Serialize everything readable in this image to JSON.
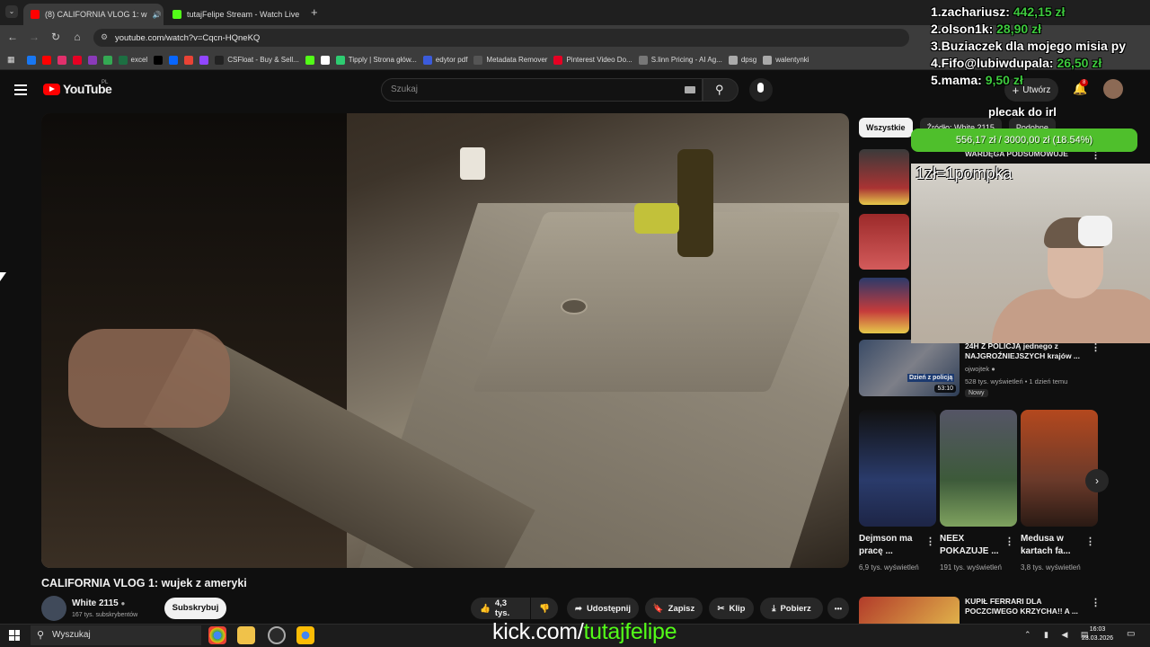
{
  "browser": {
    "tabs": [
      {
        "title": "(8) CALIFORNIA VLOG 1: w",
        "active": true,
        "favicon_color": "#ff0000"
      },
      {
        "title": "tutajFelipe Stream - Watch Live",
        "active": false,
        "favicon_color": "#53fc18"
      }
    ],
    "new_tab": "+",
    "url": "youtube.com/watch?v=Cqcn-HQneKQ",
    "bookmarks": [
      {
        "label": "",
        "color": "#1877f2"
      },
      {
        "label": "",
        "color": "#ff0000"
      },
      {
        "label": "",
        "color": "#e1306c"
      },
      {
        "label": "",
        "color": "#e60023"
      },
      {
        "label": "",
        "color": "#8a3ab9"
      },
      {
        "label": "",
        "color": "#34a853"
      },
      {
        "label": "excel",
        "color": "#1d6f42"
      },
      {
        "label": "",
        "color": "#000000"
      },
      {
        "label": "",
        "color": "#0866ff"
      },
      {
        "label": "",
        "color": "#ea4335"
      },
      {
        "label": "",
        "color": "#9146ff"
      },
      {
        "label": "CSFloat - Buy & Sell...",
        "color": "#222222"
      },
      {
        "label": "",
        "color": "#53fc18"
      },
      {
        "label": "",
        "color": "#ffffff"
      },
      {
        "label": "Tipply | Strona głów...",
        "color": "#2ecc71"
      },
      {
        "label": "edytor pdf",
        "color": "#3b5bdb"
      },
      {
        "label": "Metadata Remover",
        "color": "#555555"
      },
      {
        "label": "Pinterest Video Do...",
        "color": "#e60023"
      },
      {
        "label": "S.linn Pricing - AI Ag...",
        "color": "#777777"
      },
      {
        "label": "dpsg",
        "color": "#aaaaaa"
      },
      {
        "label": "walentynki",
        "color": "#aaaaaa"
      }
    ]
  },
  "youtube": {
    "logo_text": "YouTube",
    "country": "PL",
    "search_placeholder": "Szukaj",
    "create_label": "Utwórz",
    "notifications": "8",
    "video_title": "CALIFORNIA VLOG 1: wujek z ameryki",
    "channel_name": "White 2115",
    "channel_subs": "167 tys. subskrybentów",
    "subscribe_label": "Subskrybuj",
    "likes": "4,3 tys.",
    "share_label": "Udostępnij",
    "save_label": "Zapisz",
    "clip_label": "Klip",
    "download_label": "Pobierz",
    "more_label": "•••",
    "chips": [
      "Wszystkie",
      "Źródło: White 2115",
      "Podobne"
    ],
    "rec": {
      "title": "24H Z POLICJĄ jednego z NAJGROŹNIEJSZYCH krajów ...",
      "thumb_text": "Dzień z policją",
      "duration": "53:10",
      "channel": "ojwojtek",
      "meta": "528 tys. wyświetleń • 1 dzień temu",
      "badge": "Nowy"
    },
    "partial_rec_title": "WARDĘGA PODSUMOWUJE",
    "shorts": [
      {
        "title": "Dejmson ma pracę ...",
        "views": "6,9 tys. wyświetleń",
        "color": "#2a3b6b"
      },
      {
        "title": "NEEX POKAZUJE ...",
        "views": "191 tys. wyświetleń",
        "color": "#3d5a3a"
      },
      {
        "title": "Medusa w kartach fa...",
        "views": "3,8 tys. wyświetleń",
        "color": "#6b3a2a"
      }
    ],
    "bottom_rec_title": "KUPIŁ FERRARI DLA POCZCIWEGO KRZYCHA!! A ..."
  },
  "stream_overlay": {
    "leaderboard": [
      {
        "name": "1.zachariusz:",
        "amount": "442,15 zł"
      },
      {
        "name": "2.olson1k:",
        "amount": "28,90 zł"
      },
      {
        "name": "3.Buziaczek dla mojego misia py",
        "amount": ""
      },
      {
        "name": "4.Fifo@lubiwdupala:",
        "amount": "26,50 zł"
      },
      {
        "name": "5.mama:",
        "amount": "9,50 zł"
      }
    ],
    "goal_title": "plecak do irl",
    "goal_text": "556,17 zł / 3000,00 zł (18.54%)",
    "goal_fraction": 0.1854,
    "pompka": "1zł=1pompka",
    "kick_prefix": "kick.com/",
    "kick_channel": "tutajfelipe"
  },
  "taskbar": {
    "search_placeholder": "Wyszukaj",
    "time": "16:03",
    "date": "23.03.2026"
  }
}
